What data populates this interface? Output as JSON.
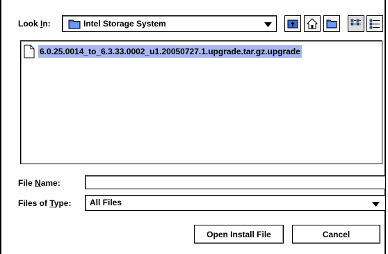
{
  "look_in": {
    "label_prefix": "Look ",
    "label_mnemonic": "I",
    "label_suffix": "n:",
    "value": "Intel Storage System",
    "icon": "folder-icon"
  },
  "toolbar": {
    "icons": [
      "up-folder-icon",
      "home-icon",
      "new-folder-icon",
      "list-view-icon",
      "details-view-icon"
    ]
  },
  "files": [
    {
      "name": "6.0.25.0014_to_6.3.33.0002_u1.20050727.1.upgrade.tar.gz.upgrade",
      "icon": "document-icon",
      "selected": true
    }
  ],
  "file_name": {
    "label_prefix": "File ",
    "label_mnemonic": "N",
    "label_suffix": "ame:",
    "value": ""
  },
  "files_of_type": {
    "label_prefix": "Files of ",
    "label_mnemonic": "T",
    "label_suffix": "ype:",
    "value": "All Files"
  },
  "buttons": {
    "open": "Open Install File",
    "cancel": "Cancel"
  },
  "colors": {
    "selection": "#a6b6f0",
    "folder": "#3a6cd9"
  }
}
